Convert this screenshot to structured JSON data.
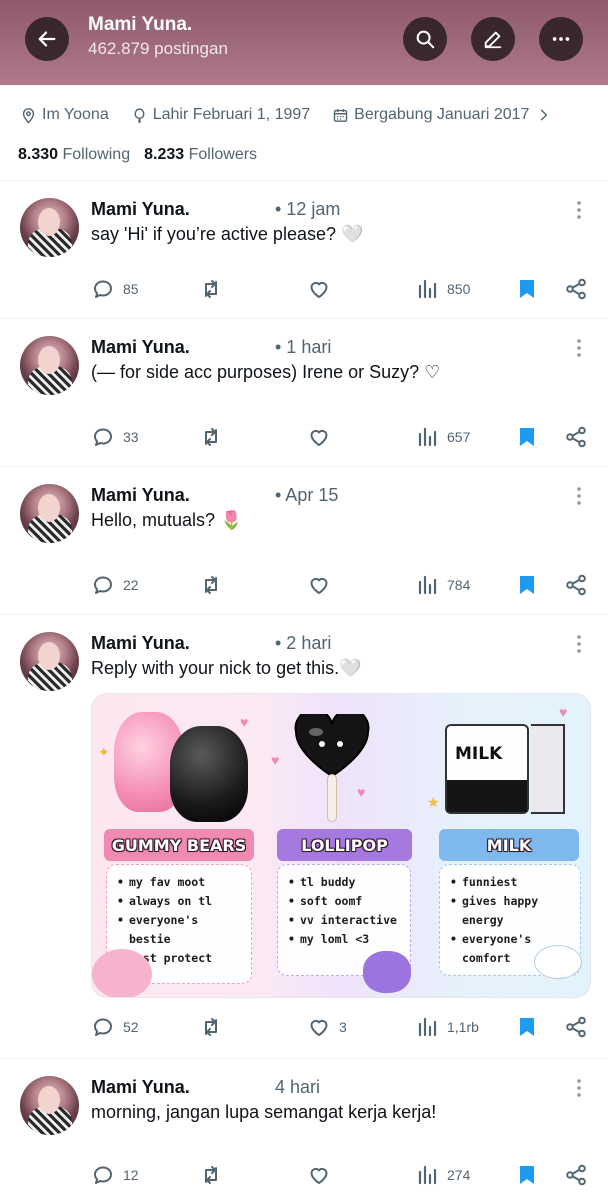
{
  "header": {
    "title": "Mami Yuna.",
    "subtitle": "462.879 postingan"
  },
  "profile": {
    "location": "Im Yoona",
    "birth": "Lahir Februari 1, 1997",
    "joined": "Bergabung Januari 2017",
    "following_count": "8.330",
    "following_label": "Following",
    "followers_count": "8.233",
    "followers_label": "Followers"
  },
  "tweets": [
    {
      "name": "Mami Yuna.",
      "time": "• 12 jam",
      "text": "say 'Hi' if you’re active please? 🤍",
      "replies": "85",
      "views": "850",
      "likes": ""
    },
    {
      "name": "Mami Yuna.",
      "time": "• 1 hari",
      "text": "(— for side acc purposes) Irene or Suzy? ♡",
      "replies": "33",
      "views": "657",
      "likes": ""
    },
    {
      "name": "Mami Yuna.",
      "time": "• Apr 15",
      "text": "Hello, mutuals? 🌷",
      "replies": "22",
      "views": "784",
      "likes": ""
    },
    {
      "name": "Mami Yuna.",
      "time": "• 2 hari",
      "text": "Reply with your nick to get this.🤍",
      "replies": "52",
      "views": "1,1rb",
      "likes": "3"
    },
    {
      "name": "Mami Yuna.",
      "time": "4 hari",
      "text": "morning, jangan lupa semangat kerja kerja!",
      "replies": "12",
      "views": "274",
      "likes": ""
    }
  ],
  "card": {
    "gummy": {
      "title": "GUMMY BEARS",
      "items": [
        "my fav moot",
        "always on tl",
        "everyone's bestie",
        "must protect"
      ]
    },
    "lollipop": {
      "title": "LOLLIPOP",
      "items": [
        "tl buddy",
        "soft oomf",
        "vv interactive",
        "my loml <3"
      ]
    },
    "milk": {
      "title": "MILK",
      "items": [
        "funniest",
        "gives happy energy",
        "everyone's comfort"
      ],
      "carton_label": "MILK"
    }
  },
  "colors": {
    "header_bg": "#9a6676",
    "accent_blue": "#1d9bf0",
    "muted": "#536471"
  },
  "icons": [
    "back-arrow-icon",
    "search-icon",
    "edit-icon",
    "more-icon",
    "location-icon",
    "birthday-icon",
    "calendar-icon",
    "reply-icon",
    "retweet-icon",
    "like-icon",
    "views-icon",
    "bookmark-icon",
    "share-icon"
  ]
}
